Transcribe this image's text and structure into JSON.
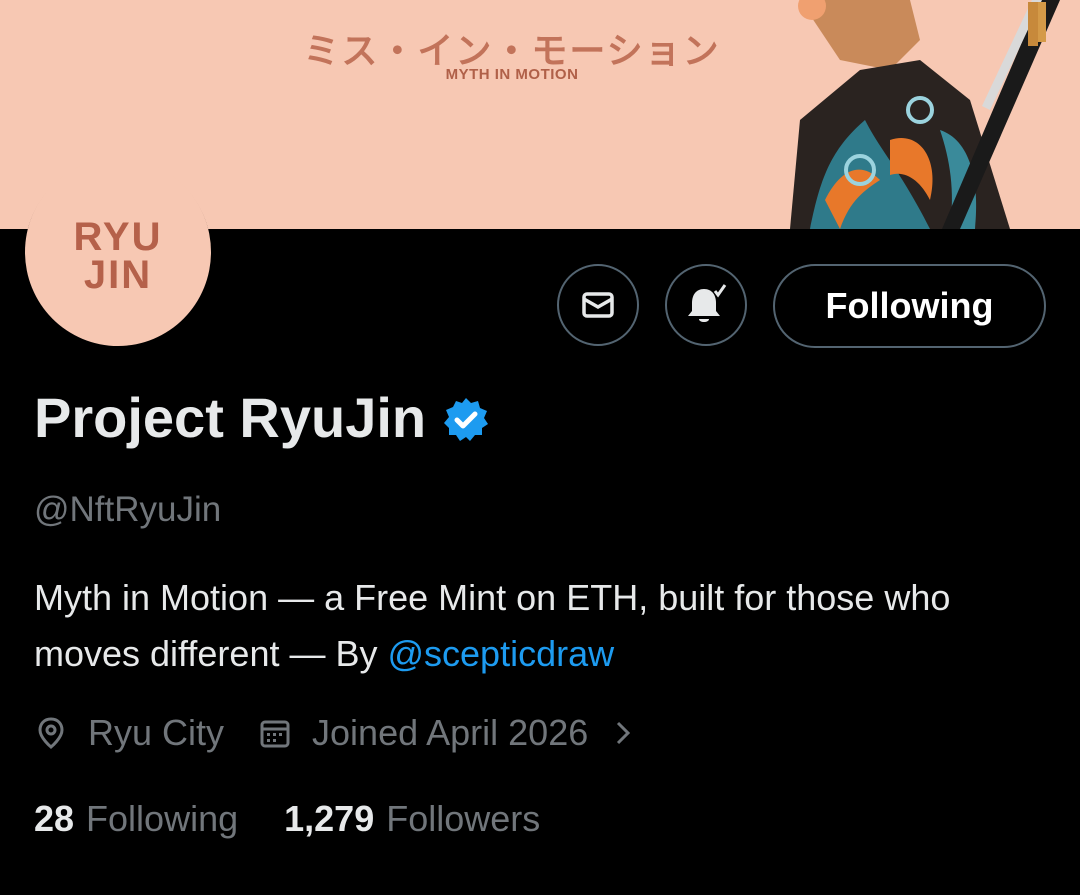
{
  "banner": {
    "japanese_title": "ミス・イン・モーション",
    "english_title": "MYTH IN MOTION"
  },
  "avatar": {
    "logo_text": "RYU JIN"
  },
  "actions": {
    "message_icon": "envelope-icon",
    "notify_icon": "bell-check-icon",
    "follow_label": "Following"
  },
  "profile": {
    "name": "Project RyuJin",
    "verified_icon": "verified-badge-icon",
    "handle": "@NftRyuJin",
    "bio_text": "Myth in Motion — a Free Mint on ETH, built for those who moves different — By ",
    "bio_mention": "@scepticdraw",
    "location": "Ryu City",
    "joined": "Joined April 2026"
  },
  "stats": {
    "following_count": "28",
    "following_label": "Following",
    "followers_count": "1,279",
    "followers_label": "Followers"
  },
  "colors": {
    "background": "#000000",
    "banner": "#f7c8b3",
    "accent": "#1d9bf0",
    "muted": "#71767b",
    "text": "#e7e9ea",
    "border": "#536471"
  }
}
